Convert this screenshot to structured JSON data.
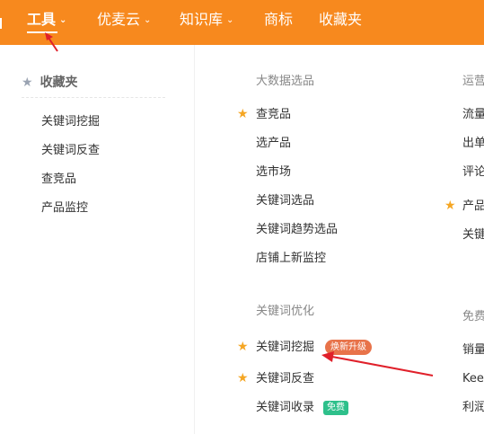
{
  "nav": {
    "items": [
      {
        "label": "工具",
        "has_dropdown": true,
        "active": true
      },
      {
        "label": "优麦云",
        "has_dropdown": true
      },
      {
        "label": "知识库",
        "has_dropdown": true
      },
      {
        "label": "商标",
        "has_dropdown": false
      },
      {
        "label": "收藏夹",
        "has_dropdown": false
      }
    ],
    "chevron_glyph": "⌄",
    "bar_color": "#f7891e"
  },
  "favorites": {
    "title": "收藏夹",
    "items": [
      "关键词挖掘",
      "关键词反查",
      "查竞品",
      "产品监控"
    ]
  },
  "big_data": {
    "title": "大数据选品",
    "items": [
      {
        "label": "查竞品",
        "starred": true
      },
      {
        "label": "选产品",
        "starred": false
      },
      {
        "label": "选市场",
        "starred": false
      },
      {
        "label": "关键词选品",
        "starred": false
      },
      {
        "label": "关键词趋势选品",
        "starred": false
      },
      {
        "label": "店铺上新监控",
        "starred": false
      }
    ]
  },
  "keyword_opt": {
    "title": "关键词优化",
    "items": [
      {
        "label": "关键词挖掘",
        "starred": true,
        "badge": "焕新升级"
      },
      {
        "label": "关键词反查",
        "starred": true
      },
      {
        "label": "关键词收录",
        "starred": false,
        "badge": "免费"
      }
    ]
  },
  "right_col_top": {
    "title": "运营",
    "items": [
      "流量",
      "出单",
      "评论",
      "产品",
      "关键"
    ]
  },
  "right_col_bottom": {
    "title": "免费",
    "items": [
      "销量",
      "Kee",
      "利润"
    ]
  },
  "colors": {
    "star": "#f5a623",
    "badge_upgrade": "#e8734a",
    "badge_free": "#2ec08b",
    "annotation_arrow": "#e0202a"
  }
}
